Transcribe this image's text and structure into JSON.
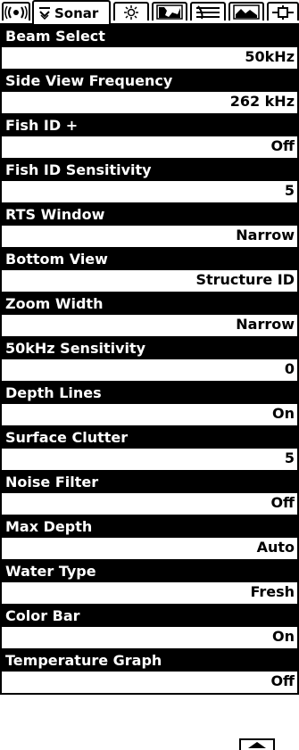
{
  "tabs": {
    "first_icon": "radar-icon",
    "sonar": {
      "label": "Sonar",
      "icon": "sonar-icon"
    },
    "others": [
      {
        "name": "tab-sun",
        "icon": "sun-icon"
      },
      {
        "name": "tab-map",
        "icon": "map-icon"
      },
      {
        "name": "tab-sonar-graph",
        "icon": "sonar-graph-icon"
      },
      {
        "name": "tab-picture",
        "icon": "picture-icon"
      },
      {
        "name": "tab-setup",
        "icon": "setup-icon"
      }
    ]
  },
  "menu": {
    "items": [
      {
        "label": "Beam Select",
        "value": "50kHz"
      },
      {
        "label": "Side View Frequency",
        "value": "262 kHz"
      },
      {
        "label": "Fish ID +",
        "value": "Off"
      },
      {
        "label": "Fish ID Sensitivity",
        "value": "5"
      },
      {
        "label": "RTS Window",
        "value": "Narrow"
      },
      {
        "label": "Bottom View",
        "value": "Structure ID"
      },
      {
        "label": "Zoom Width",
        "value": "Narrow"
      },
      {
        "label": "50kHz Sensitivity",
        "value": "0"
      },
      {
        "label": "Depth Lines",
        "value": "On"
      },
      {
        "label": "Surface Clutter",
        "value": "5"
      },
      {
        "label": "Noise Filter",
        "value": "Off"
      },
      {
        "label": "Max Depth",
        "value": "Auto"
      },
      {
        "label": "Water Type",
        "value": "Fresh"
      },
      {
        "label": "Color Bar",
        "value": "On"
      },
      {
        "label": "Temperature Graph",
        "value": "Off"
      }
    ]
  },
  "colors": {
    "foreground": "#000000",
    "background": "#ffffff"
  }
}
